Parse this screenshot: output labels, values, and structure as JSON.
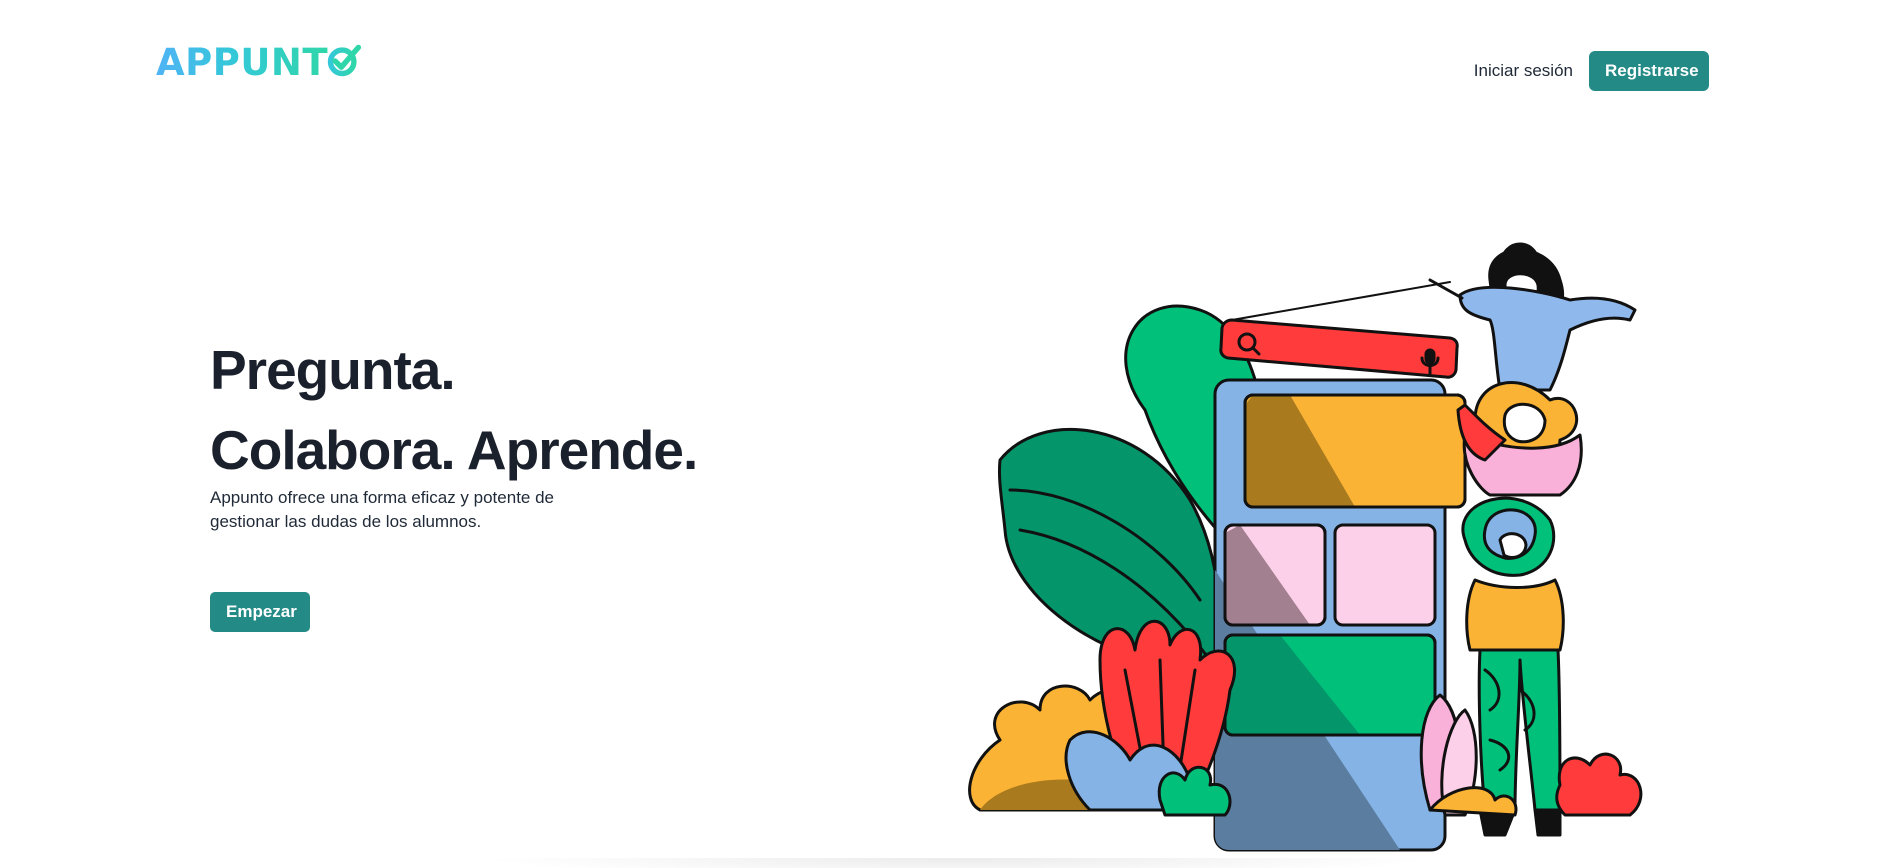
{
  "header": {
    "logo_text": "APPUNT",
    "login_label": "Iniciar sesión",
    "signup_label": "Registrarse"
  },
  "hero": {
    "title_line1": "Pregunta.",
    "title_line2": "Colabora. Aprende.",
    "description": "Appunto ofrece una forma eficaz y potente de gestionar las dudas de los alumnos.",
    "cta_label": "Empezar"
  },
  "colors": {
    "accent": "#238a86",
    "logo_gradient_start": "#4fb3f5",
    "logo_gradient_end": "#2fd6a9",
    "text": "#1a202c"
  },
  "icons": {
    "logo_check": "check-icon",
    "search": "search-icon",
    "microphone": "microphone-icon"
  }
}
